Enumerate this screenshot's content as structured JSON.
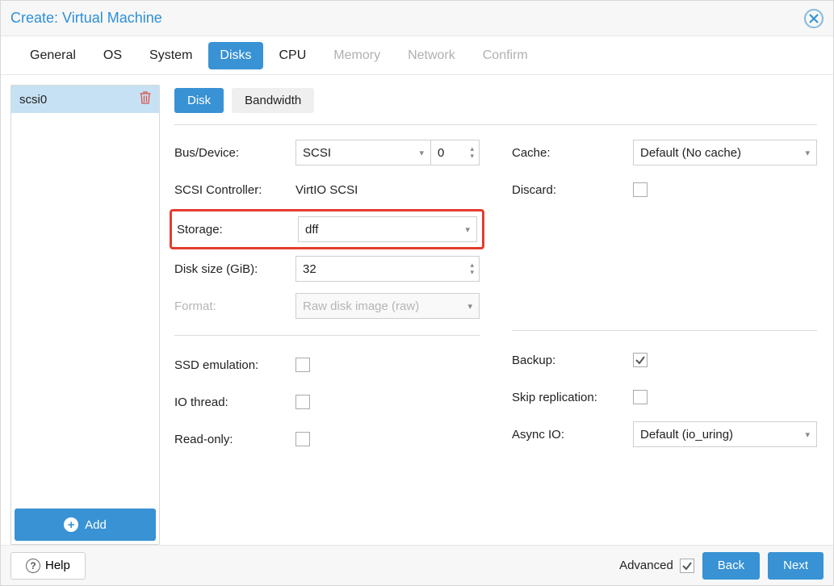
{
  "title": "Create: Virtual Machine",
  "tabs": {
    "general": "General",
    "os": "OS",
    "system": "System",
    "disks": "Disks",
    "cpu": "CPU",
    "memory": "Memory",
    "network": "Network",
    "confirm": "Confirm"
  },
  "disk_list": {
    "items": [
      {
        "name": "scsi0"
      }
    ],
    "add_label": "Add"
  },
  "subtabs": {
    "disk": "Disk",
    "bandwidth": "Bandwidth"
  },
  "form": {
    "left": {
      "bus_device_label": "Bus/Device:",
      "bus_value": "SCSI",
      "device_value": "0",
      "scsi_controller_label": "SCSI Controller:",
      "scsi_controller_value": "VirtIO SCSI",
      "storage_label": "Storage:",
      "storage_value": "dff",
      "disk_size_label": "Disk size (GiB):",
      "disk_size_value": "32",
      "format_label": "Format:",
      "format_value": "Raw disk image (raw)",
      "ssd_emulation_label": "SSD emulation:",
      "io_thread_label": "IO thread:",
      "read_only_label": "Read-only:"
    },
    "right": {
      "cache_label": "Cache:",
      "cache_value": "Default (No cache)",
      "discard_label": "Discard:",
      "backup_label": "Backup:",
      "skip_replication_label": "Skip replication:",
      "async_io_label": "Async IO:",
      "async_io_value": "Default (io_uring)"
    }
  },
  "footer": {
    "help": "Help",
    "advanced": "Advanced",
    "back": "Back",
    "next": "Next"
  }
}
